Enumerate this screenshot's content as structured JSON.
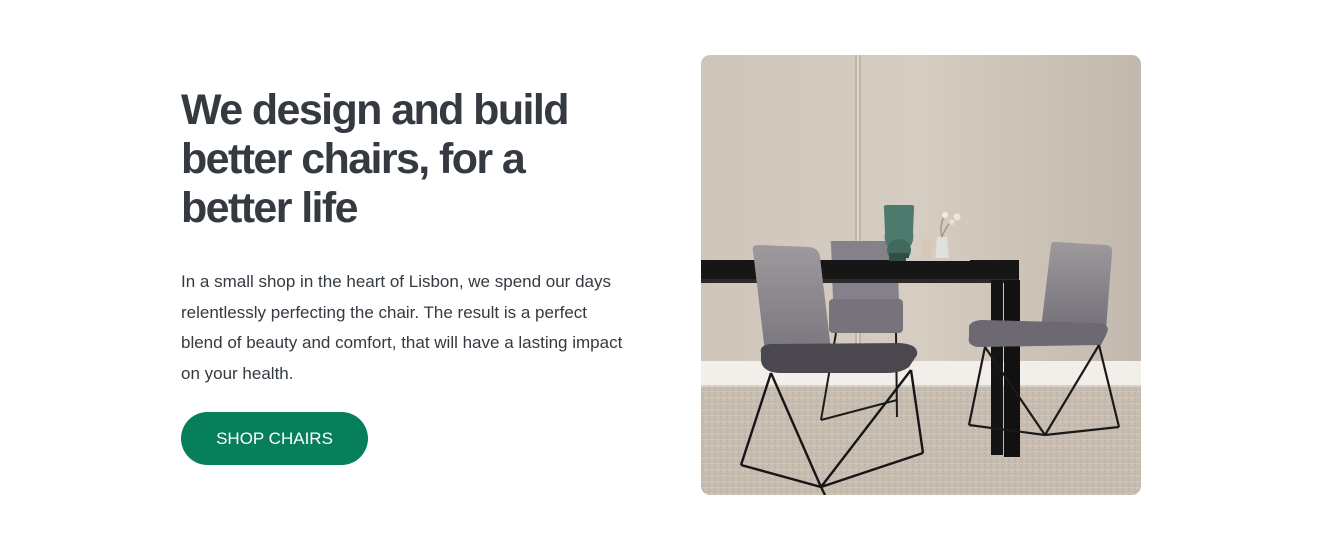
{
  "hero": {
    "headline": "We design and build better chairs, for a better life",
    "description": "In a small shop in the heart of Lisbon, we spend our days relentlessly perfecting the chair. The result is a perfect blend of beauty and comfort, that will have a lasting impact on your health.",
    "cta_label": "SHOP CHAIRS"
  },
  "colors": {
    "accent": "#087f5b",
    "text": "#343a40",
    "background": "#ffffff"
  }
}
